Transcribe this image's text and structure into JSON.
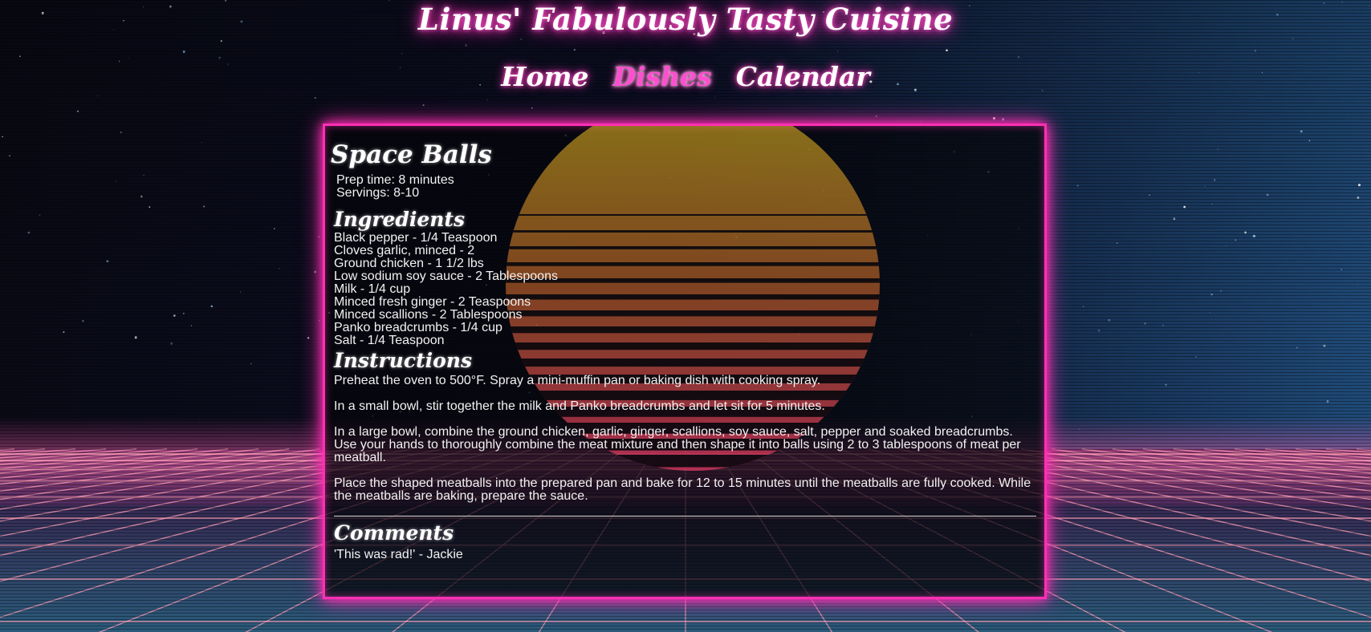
{
  "site": {
    "title": "Linus' Fabulously Tasty Cuisine"
  },
  "nav": {
    "items": [
      {
        "label": "Home",
        "active": false
      },
      {
        "label": "Dishes",
        "active": true
      },
      {
        "label": "Calendar",
        "active": false
      }
    ]
  },
  "recipe": {
    "title": "Space Balls",
    "prep_time": "Prep time: 8 minutes",
    "servings": "Servings: 8-10",
    "ingredients_heading": "Ingredients",
    "ingredients": [
      "Black pepper - 1/4 Teaspoon",
      "Cloves garlic, minced - 2",
      "Ground chicken - 1 1/2 lbs",
      "Low sodium soy sauce - 2 Tablespoons",
      "Milk - 1/4 cup",
      "Minced fresh ginger - 2 Teaspoons",
      "Minced scallions - 2 Tablespoons",
      "Panko breadcrumbs - 1/4 cup",
      "Salt - 1/4 Teaspoon"
    ],
    "instructions_heading": "Instructions",
    "instructions": [
      "Preheat the oven to 500°F. Spray a mini-muffin pan or baking dish with cooking spray.",
      "In a small bowl, stir together the milk and Panko breadcrumbs and let sit for 5 minutes.",
      "In a large bowl, combine the ground chicken, garlic, ginger, scallions, soy sauce, salt, pepper and soaked breadcrumbs. Use your hands to thoroughly combine the meat mixture and then shape it into balls using 2 to 3 tablespoons of meat per meatball.",
      "Place the shaped meatballs into the prepared pan and bake for 12 to 15 minutes until the meatballs are fully cooked. While the meatballs are baking, prepare the sauce."
    ],
    "comments_heading": "Comments",
    "comments": [
      "'This was rad!' - Jackie"
    ]
  },
  "theme": {
    "accent": "#ff2fb4",
    "accent_light": "#ff52c8",
    "sky_top": "#0b0b1e",
    "sky_right": "#1b3a66",
    "grid_color": "#ff9fb8",
    "sun_top": "#d8b81e",
    "sun_bottom": "#ff3d6e"
  }
}
